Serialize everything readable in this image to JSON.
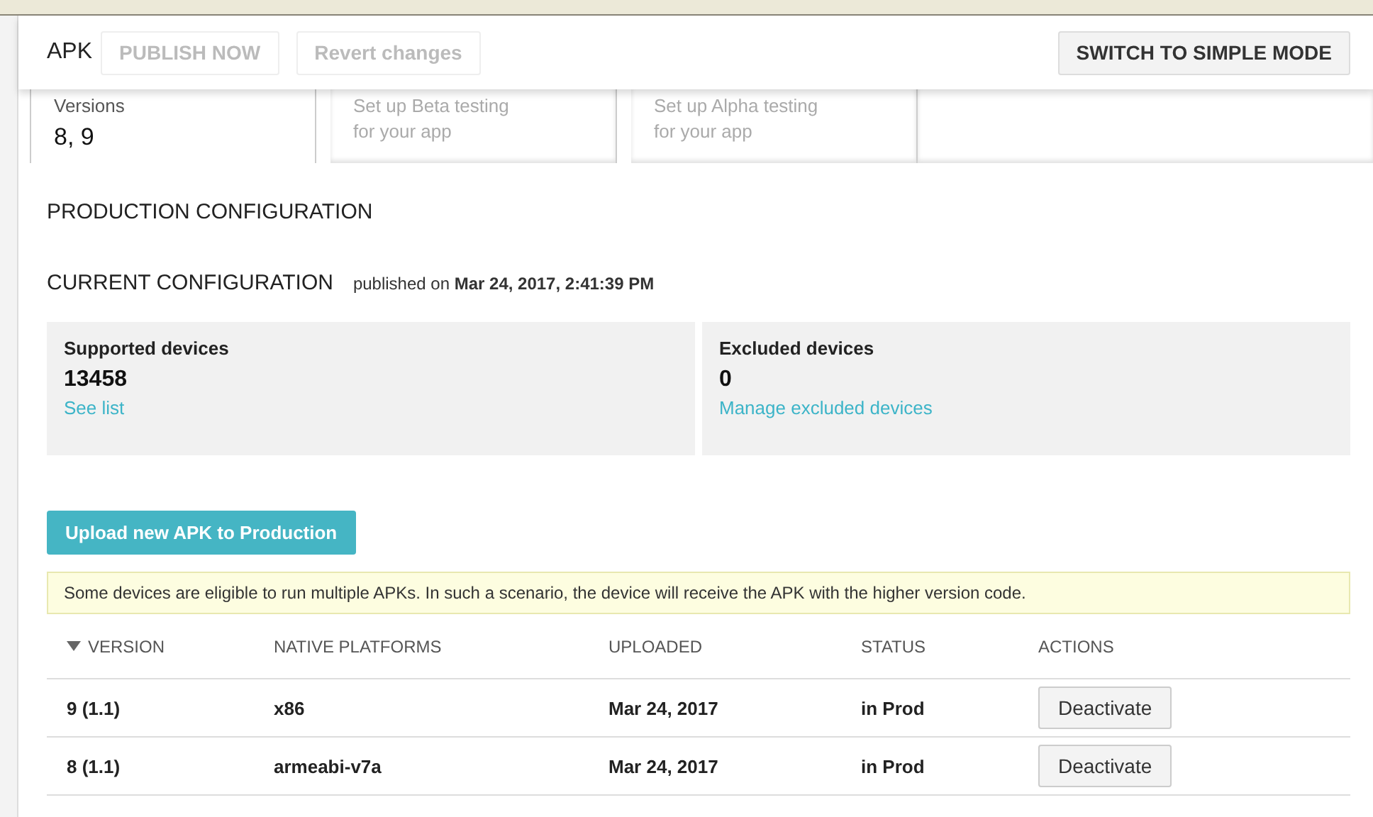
{
  "header": {
    "title": "APK",
    "buttons": [
      {
        "label": "PUBLISH NOW",
        "disabled": true
      },
      {
        "label": "Revert changes",
        "disabled": true
      }
    ],
    "mode_button": {
      "label": "SWITCH TO SIMPLE MODE",
      "disabled": false
    }
  },
  "tabs": [
    {
      "lines": [
        "Versions"
      ],
      "value": "8, 9",
      "selected": true
    },
    {
      "lines": [
        "Set up Beta testing",
        "for your app"
      ],
      "selected": false
    },
    {
      "lines": [
        "Set up Alpha testing",
        "for your app"
      ],
      "selected": false
    }
  ],
  "section_title": "PRODUCTION CONFIGURATION",
  "current": {
    "title": "CURRENT CONFIGURATION",
    "published": "published on **Mar 24, 2017, 2:41:39 PM**"
  },
  "device_cards": [
    {
      "label": "Supported devices",
      "count": "13458",
      "link": "See list"
    },
    {
      "label": "Excluded devices",
      "count": "0",
      "link": "Manage excluded devices"
    }
  ],
  "upload_button": "Upload new APK to Production",
  "notice": "Some devices are eligible to run multiple APKs. In such a scenario, the device will receive the APK with the higher version code.",
  "table": {
    "columns": [
      {
        "label": "VERSION",
        "sorted": true
      },
      {
        "label": "NATIVE PLATFORMS",
        "sorted": false
      },
      {
        "label": "UPLOADED",
        "sorted": false
      },
      {
        "label": "STATUS",
        "sorted": false
      },
      {
        "label": "ACTIONS",
        "sorted": false
      }
    ],
    "rows": [
      {
        "cells": [
          "9 (1.1)",
          "x86",
          "Mar 24, 2017",
          "in Prod"
        ],
        "action": "Deactivate"
      },
      {
        "cells": [
          "8 (1.1)",
          "armeabi-v7a",
          "Mar 24, 2017",
          "in Prod"
        ],
        "action": "Deactivate"
      }
    ]
  }
}
